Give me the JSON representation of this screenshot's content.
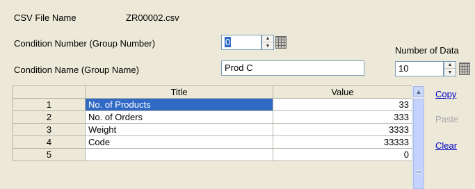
{
  "csv": {
    "label": "CSV File Name",
    "value": "ZR00002.csv"
  },
  "condition_number": {
    "label": "Condition Number (Group Number)",
    "value": "0"
  },
  "number_of_data": {
    "label": "Number of Data",
    "value": "10"
  },
  "condition_name": {
    "label": "Condition Name (Group Name)",
    "value": "Prod C"
  },
  "table": {
    "headers": [
      "",
      "Title",
      "Value"
    ],
    "rows": [
      {
        "num": "1",
        "title": "No. of Products",
        "value": "33"
      },
      {
        "num": "2",
        "title": "No. of Orders",
        "value": "333"
      },
      {
        "num": "3",
        "title": "Weight",
        "value": "3333"
      },
      {
        "num": "4",
        "title": "Code",
        "value": "33333"
      },
      {
        "num": "5",
        "title": "",
        "value": "0"
      }
    ]
  },
  "actions": {
    "copy": "Copy",
    "paste": "Paste",
    "clear": "Clear"
  },
  "icons": {
    "spinner": "spin-up-down-icon",
    "grid": "grid-icon",
    "scroll_up": "scroll-up-arrow-icon"
  }
}
